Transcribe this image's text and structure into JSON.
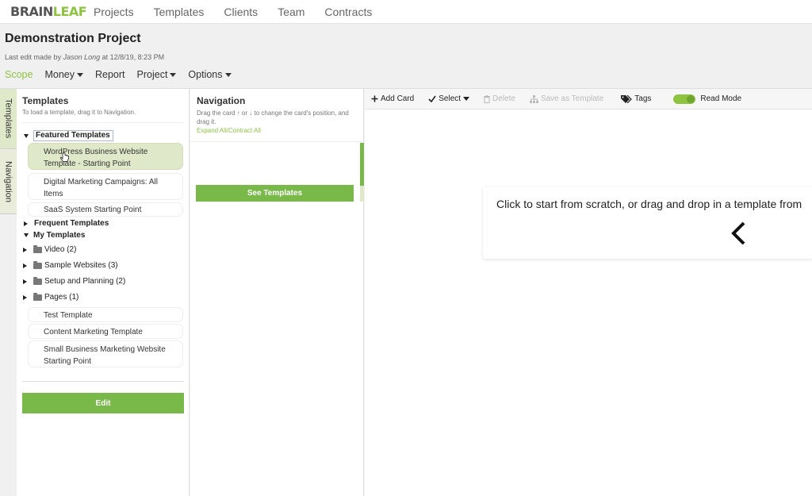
{
  "logo": {
    "part1": "BRAIN",
    "part2": "LEAF"
  },
  "topnav": {
    "items": [
      "Projects",
      "Templates",
      "Clients",
      "Team",
      "Contracts"
    ]
  },
  "project": {
    "title": "Demonstration Project",
    "meta_prefix": "Last edit made by",
    "meta_user": "Jason Long",
    "meta_suffix": "at 12/8/19, 8:23 PM",
    "tabs": [
      {
        "label": "Scope",
        "caret": false
      },
      {
        "label": "Money",
        "caret": true
      },
      {
        "label": "Report",
        "caret": false
      },
      {
        "label": "Project",
        "caret": true
      },
      {
        "label": "Options",
        "caret": true
      }
    ]
  },
  "vtabs": [
    "Templates",
    "Navigation"
  ],
  "templates_panel": {
    "title": "Templates",
    "subtitle": "To load a template, drag it to Navigation.",
    "featured_label": "Featured Templates",
    "featured": [
      "WordPress Business Website Template - Starting Point",
      "Digital Marketing Campaigns: All Items",
      "SaaS System Starting Point"
    ],
    "frequent_label": "Frequent Templates",
    "my_label": "My Templates",
    "folders": [
      "Video (2)",
      "Sample Websites (3)",
      "Setup and Planning (2)",
      "Pages (1)"
    ],
    "my_items": [
      "Test Template",
      "Content Marketing Template",
      "Small Business Marketing Website Starting Point"
    ],
    "edit_label": "Edit"
  },
  "nav_panel": {
    "title": "Navigation",
    "subtitle": "Drag the card ↑ or ↓ to change the card's position, and drag it.",
    "expand_label": "Expand All/Contract All",
    "see_templates_label": "See Templates"
  },
  "toolbar": {
    "add_card": "Add Card",
    "select": "Select",
    "delete": "Delete",
    "save_template": "Save as Template",
    "tags": "Tags",
    "read_mode": "Read Mode"
  },
  "main": {
    "drop_text": "Click to start from scratch, or drag and drop in a template from"
  },
  "colors": {
    "accent": "#8dc33f",
    "button": "#79b94a",
    "selected": "#dfe9c9"
  }
}
